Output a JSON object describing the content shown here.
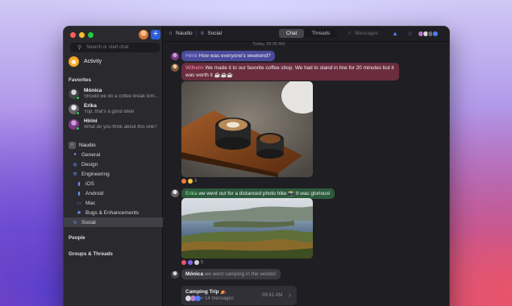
{
  "sidebar": {
    "search_placeholder": "Search or start chat",
    "compose_label": "+",
    "activity_label": "Activity",
    "favorites_header": "Favorites",
    "favorites": [
      {
        "name": "Mónica",
        "preview": "Should we do a coffee break tomorrow?"
      },
      {
        "name": "Erika",
        "preview": "Yup, that's a good idea!"
      },
      {
        "name": "Hirini",
        "preview": "What do you think about this one?"
      }
    ],
    "workspace": "Naudio",
    "channels": [
      {
        "label": "General",
        "icon": "hash-icon"
      },
      {
        "label": "Design",
        "icon": "palette-icon"
      },
      {
        "label": "Engineering",
        "icon": "wrench-icon"
      },
      {
        "label": "iOS",
        "icon": "phone-icon"
      },
      {
        "label": "Android",
        "icon": "phone-icon"
      },
      {
        "label": "Mac",
        "icon": "laptop-icon"
      },
      {
        "label": "Bugs & Enhancements",
        "icon": "bug-icon"
      },
      {
        "label": "Social",
        "icon": "social-icon"
      }
    ],
    "people_header": "People",
    "groups_header": "Groups & Threads"
  },
  "topbar": {
    "workspace": "Naudio",
    "channel": "Social",
    "tab_chat": "Chat",
    "tab_threads": "Threads",
    "messages_label": "Messages"
  },
  "timeline": {
    "timestamp": "Today, 09:30 AM",
    "messages": [
      {
        "author": "Hirini",
        "text": "How was everyone's weekend?",
        "author_color": "#bfb8ff"
      },
      {
        "author": "Wilhelm",
        "text": "We made it to our favorite coffee shop. We had to stand in line for 20 minutes but it was worth it ☕☕☕",
        "author_color": "#ff8fae"
      },
      {
        "author": "Erika",
        "text": "we went out for a distanced photo hike 📸 It was glorious!",
        "author_color": "#8de3a6"
      },
      {
        "author": "Mónica",
        "text": "we went camping in the woods!",
        "author_color": "#f0f0f4"
      }
    ],
    "reactions_1_count": "3",
    "reactions_2_count": "5",
    "thread": {
      "title": "Camping Trip ⛺",
      "count": "+ 14 messages",
      "time": "09:41 AM"
    }
  },
  "colors": {
    "accent": "#2d5dd8",
    "online": "#34c759"
  }
}
